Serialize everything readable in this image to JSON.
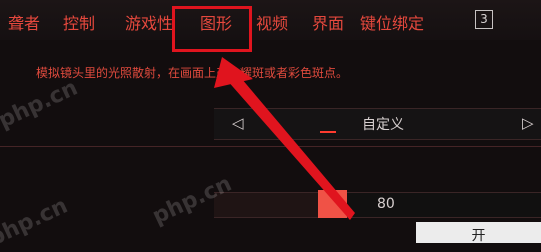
{
  "tabs": [
    {
      "label": "聋者"
    },
    {
      "label": "控制"
    },
    {
      "label": "游戏性"
    },
    {
      "label": "图形"
    },
    {
      "label": "视频"
    },
    {
      "label": "界面"
    },
    {
      "label": "键位绑定"
    }
  ],
  "tab_badge": "3",
  "description": "模拟镜头里的光照散射，在画面上产生耀斑或者彩色斑点。",
  "selector": {
    "left_arrow": "◁",
    "value": "自定义",
    "right_arrow": "▷"
  },
  "slider": {
    "value": "80"
  },
  "toggle_button": "开",
  "watermark": "php.cn",
  "colors": {
    "accent": "#e5483d",
    "highlight": "#e0141e",
    "thumb": "#f05246"
  }
}
